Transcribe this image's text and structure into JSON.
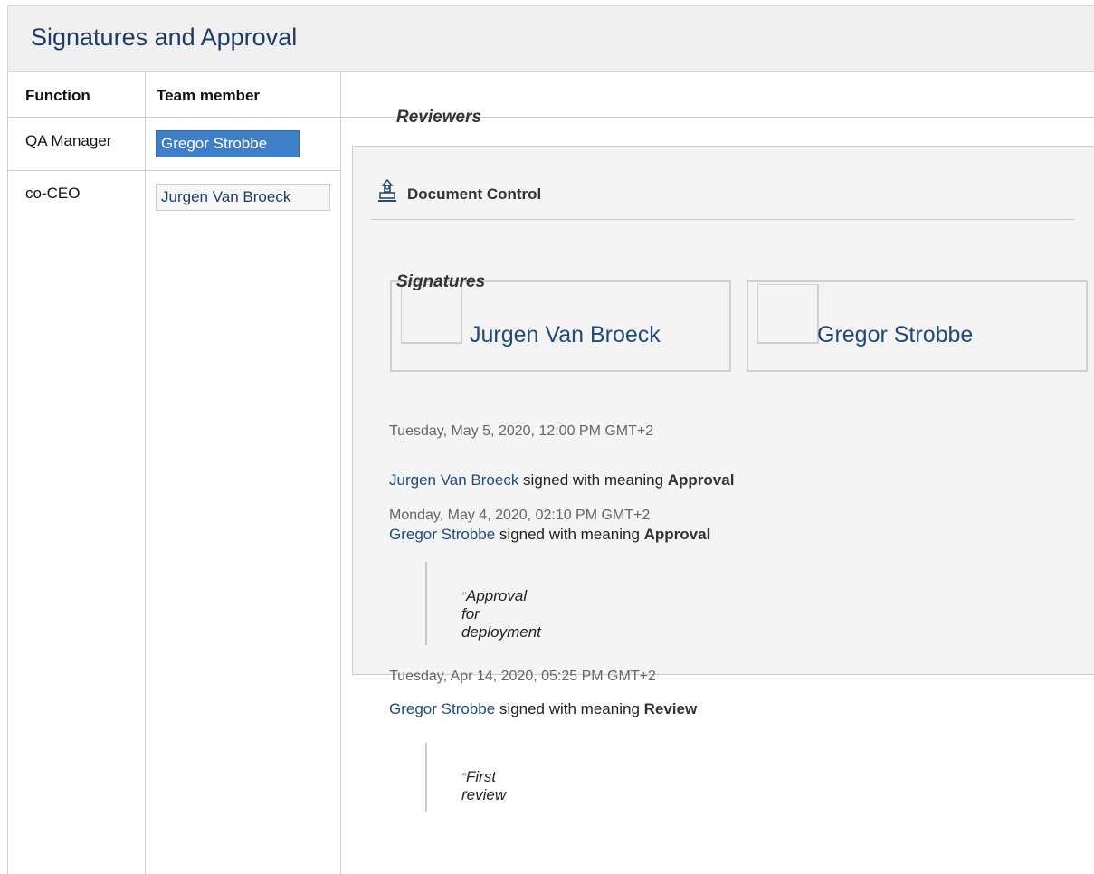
{
  "header": {
    "title": "Signatures and Approval"
  },
  "table": {
    "columns": [
      "Function",
      "Team member"
    ],
    "rows": [
      {
        "function": "QA Manager",
        "member": "Gregor Strobbe",
        "selected": true
      },
      {
        "function": "co-CEO",
        "member": "Jurgen Van Broeck",
        "selected": false
      }
    ]
  },
  "document_control": {
    "title": "Document Control",
    "icon": "stamp-icon",
    "reviewers_label": "Reviewers",
    "reviewers": [
      {
        "name": "Jurgen Van Broeck"
      },
      {
        "name": "Gregor Strobbe"
      }
    ],
    "signatures_label": "Signatures",
    "signatures": [
      {
        "date": "Tuesday, May 5, 2020, 12:00 PM GMT+2",
        "signer": "Jurgen Van Broeck",
        "middle": " signed with meaning ",
        "meaning": "Approval",
        "comment": ""
      },
      {
        "date": "Monday, May 4, 2020, 02:10 PM GMT+2",
        "signer": "Gregor Strobbe",
        "middle": " signed with meaning ",
        "meaning": "Approval",
        "comment": "Approval for deployment"
      },
      {
        "date": "Tuesday, Apr 14, 2020, 05:25 PM GMT+2",
        "signer": "Gregor Strobbe",
        "middle": " signed with meaning ",
        "meaning": "Review",
        "comment": "First review"
      }
    ],
    "quote_open": "“",
    "quote_close": "”"
  },
  "colors": {
    "accent": "#3f7fc8",
    "link": "#1f4a7a",
    "title": "#1f3a66"
  }
}
